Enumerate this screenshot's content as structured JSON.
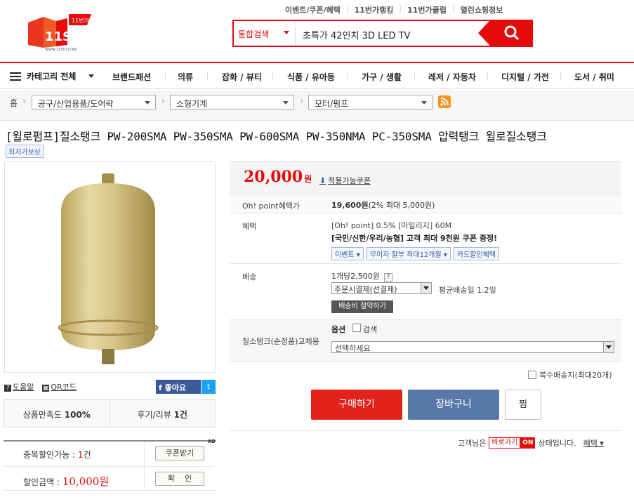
{
  "header": {
    "toplinks": [
      "이벤트/쿠폰/혜택",
      "11번가랭킹",
      "11번가클럽",
      "열린쇼핑정보"
    ],
    "logo_text": "11ST",
    "logo_sub": "11번가",
    "logo_url_text": "WWW.11ST.CO.KR",
    "search": {
      "scope": "통합검색",
      "query": "초특가 42인치 3D LED TV"
    }
  },
  "nav": {
    "all_label": "카테고리 전체",
    "items": [
      "브랜드패션",
      "의류",
      "잡화 / 뷰티",
      "식품 / 유아동",
      "가구 / 생활",
      "레저 / 자동차",
      "디지털 / 가전",
      "도서 / 취미"
    ]
  },
  "breadcrumb": {
    "home": "홈",
    "levels": [
      "공구/산업용품/도어락",
      "소형기계",
      "모터/펌프"
    ]
  },
  "product": {
    "title": "[윌로펌프]질소탱크 PW-200SMA PW-350SMA PW-600SMA PW-350NMA PC-350SMA 압력탱크 윌로질소탱크",
    "badge": "최저가보상",
    "links": {
      "howto": "도움말",
      "qr": "QR코드"
    },
    "like_label": "좋아요",
    "stats": {
      "satisfaction_label": "상품만족도",
      "satisfaction_value": "100%",
      "review_label": "후기/리뷰",
      "review_value": "1건"
    },
    "coupon": {
      "dup_label": "중복할인가능 : ",
      "dup_count": "1",
      "dup_unit": "건",
      "get_btn": "쿠폰받기",
      "disc_label": "할인금액 : ",
      "disc_value": "10,000원",
      "confirm_btn": "확    인",
      "ad": "AD"
    },
    "price": {
      "amount": "20,000",
      "unit": "원",
      "coupon_link": "적용가능쿠폰"
    },
    "point": {
      "label": "Oh! point혜택가",
      "value": "19,600원",
      "note": "(2% 최대 5,000원)"
    },
    "benefit": {
      "label": "혜택",
      "line1": "[Oh! point] 0.5% [마일리지] 60M",
      "line2": "[국민/신한/우리/농협] 고객 최대 9천원 쿠폰 증정!",
      "chips": [
        "이벤트 ▾",
        "무이자 할부 최대12개월 ▾",
        "카드할인혜택"
      ]
    },
    "shipping": {
      "label": "배송",
      "fee": "1개당2,500원",
      "q": "?",
      "method": "주문시결제(선결제)",
      "avg": "평균배송일 1.2일",
      "save_btn": "배송비 절약하기"
    },
    "option": {
      "label": "질소탱크(순정품)교체용",
      "head": "옵션",
      "search_label": "검색",
      "placeholder": "선택하세요"
    },
    "multi_ship": "복수배송지(최대20개)",
    "buttons": {
      "buy": "구매하기",
      "cart": "장바구니",
      "zzim": "찜"
    },
    "customer": {
      "prefix": "고객님은",
      "paro": "바로가기",
      "on": "ON",
      "suffix": "상태입니다.",
      "toggle": "혜택 ▾"
    }
  },
  "colors": {
    "brand_red": "#e60b0b",
    "cart_blue": "#5978aa"
  }
}
